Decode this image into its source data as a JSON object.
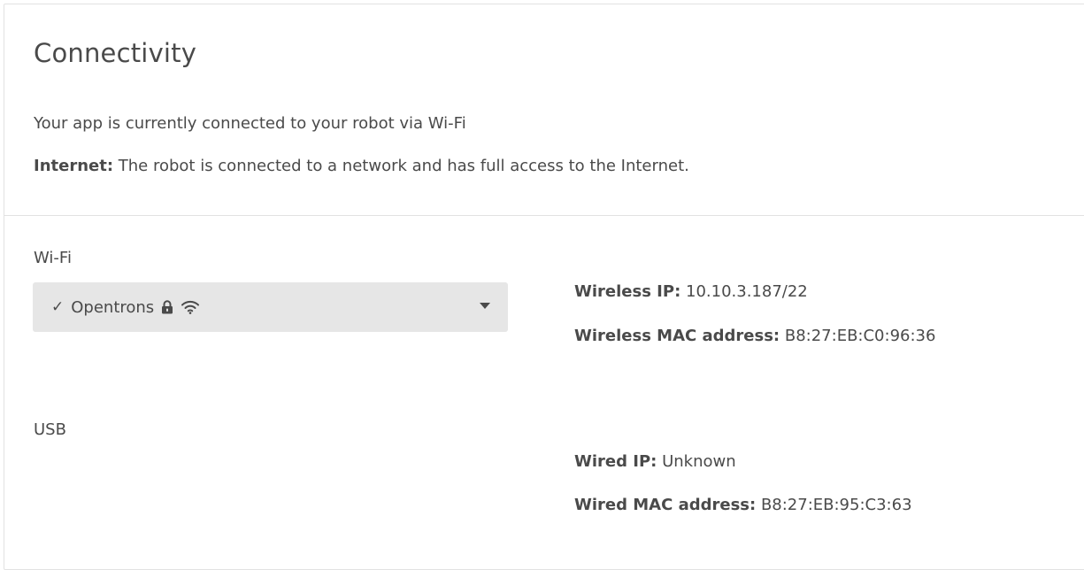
{
  "title": "Connectivity",
  "connection_status": "Your app is currently connected to your robot via Wi-Fi",
  "internet": {
    "label": "Internet:",
    "text": " The robot is connected to a network and has full access to the Internet."
  },
  "wifi": {
    "section_label": "Wi-Fi",
    "selected_network": "Opentrons",
    "selected_mark": "✓",
    "secured_icon": "lock-icon",
    "signal_icon": "wifi-signal-icon",
    "details": [
      {
        "label": "Wireless IP:",
        "value": " 10.10.3.187/22"
      },
      {
        "label": "Wireless MAC address:",
        "value": " B8:27:EB:C0:96:36"
      }
    ]
  },
  "usb": {
    "section_label": "USB",
    "details": [
      {
        "label": "Wired IP:",
        "value": " Unknown"
      },
      {
        "label": "Wired MAC address:",
        "value": " B8:27:EB:95:C3:63"
      }
    ]
  }
}
